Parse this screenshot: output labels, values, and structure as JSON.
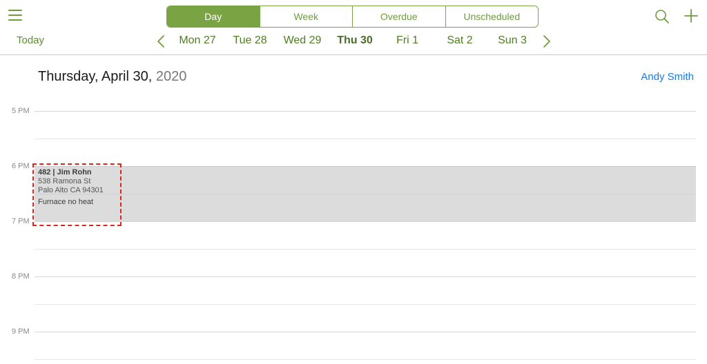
{
  "toolbar": {
    "view_tabs": [
      {
        "label": "Day"
      },
      {
        "label": "Week"
      },
      {
        "label": "Overdue"
      },
      {
        "label": "Unscheduled"
      }
    ],
    "active_view": "Day",
    "today_label": "Today"
  },
  "week_strip": {
    "days": [
      {
        "label": "Mon 27"
      },
      {
        "label": "Tue 28"
      },
      {
        "label": "Wed 29"
      },
      {
        "label": "Thu 30"
      },
      {
        "label": "Fri 1"
      },
      {
        "label": "Sat 2"
      },
      {
        "label": "Sun 3"
      }
    ],
    "selected_day": "Thu 30"
  },
  "header": {
    "date_text": "Thursday, April 30,",
    "year_text": "2020",
    "user_name": "Andy Smith"
  },
  "timeline": {
    "hours": [
      "5 PM",
      "6 PM",
      "7 PM",
      "8 PM",
      "9 PM"
    ]
  },
  "event": {
    "title": "482 | Jim Rohn",
    "address_line1": "538 Ramona St",
    "address_line2": "Palo Alto CA 94301",
    "description": "Furnace no heat"
  },
  "colors": {
    "accent": "#7aa444",
    "link": "#1a7ae0",
    "event_bg": "#dcdcdc",
    "focus_outline": "#d9251f"
  },
  "icons": {
    "menu": "hamburger-menu-icon",
    "search": "search-icon",
    "add": "plus-icon",
    "prev": "chevron-left-icon",
    "next": "chevron-right-icon"
  }
}
